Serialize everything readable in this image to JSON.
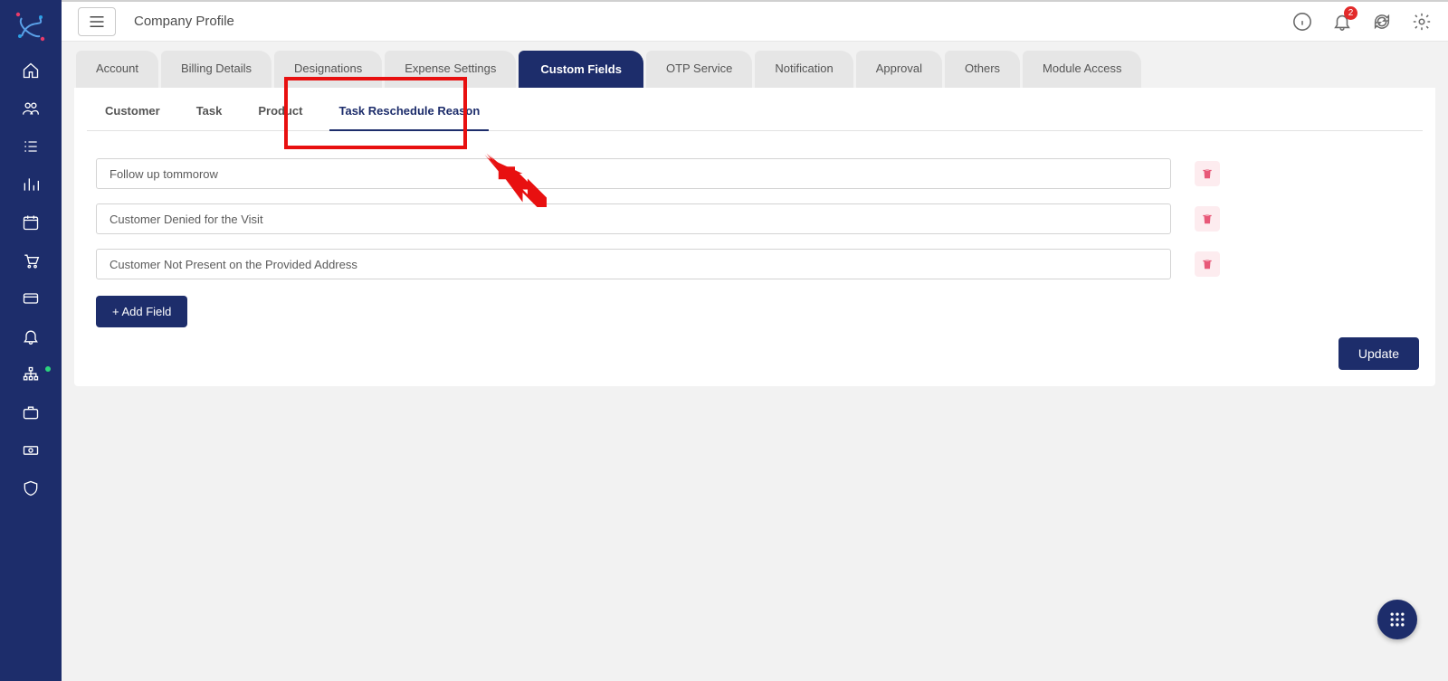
{
  "header": {
    "title": "Company Profile",
    "notification_badge": "2"
  },
  "sidebar": {
    "items": [
      "home",
      "users",
      "tasks",
      "analytics",
      "calendar",
      "cart",
      "card",
      "bell",
      "org",
      "briefcase",
      "money",
      "shield"
    ]
  },
  "tabs_primary": [
    {
      "label": "Account",
      "active": false
    },
    {
      "label": "Billing Details",
      "active": false
    },
    {
      "label": "Designations",
      "active": false
    },
    {
      "label": "Expense Settings",
      "active": false
    },
    {
      "label": "Custom Fields",
      "active": true
    },
    {
      "label": "OTP Service",
      "active": false
    },
    {
      "label": "Notification",
      "active": false
    },
    {
      "label": "Approval",
      "active": false
    },
    {
      "label": "Others",
      "active": false
    },
    {
      "label": "Module Access",
      "active": false
    }
  ],
  "tabs_secondary": [
    {
      "label": "Customer",
      "active": false
    },
    {
      "label": "Task",
      "active": false
    },
    {
      "label": "Product",
      "active": false
    },
    {
      "label": "Task Reschedule Reason",
      "active": true
    }
  ],
  "fields": [
    {
      "value": "Follow up tommorow"
    },
    {
      "value": "Customer Denied for the Visit"
    },
    {
      "value": "Customer Not Present on the Provided Address"
    }
  ],
  "buttons": {
    "add_field": "+ Add Field",
    "update": "Update"
  },
  "annotation": {
    "highlight_target": "Task Reschedule Reason"
  }
}
